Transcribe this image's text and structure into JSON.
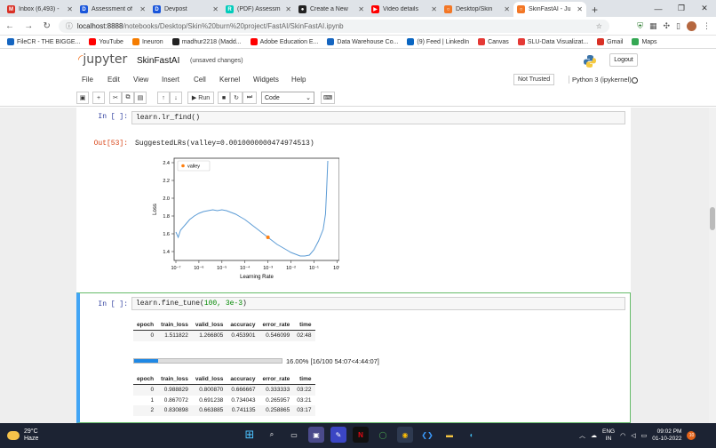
{
  "browser": {
    "tabs": [
      {
        "label": "Inbox (6,493) -",
        "icon": "gmail-icon",
        "color": "#d93025",
        "glyph": "M"
      },
      {
        "label": "Assessment of",
        "icon": "document-icon",
        "color": "#1a56db",
        "glyph": "D"
      },
      {
        "label": "Devpost",
        "icon": "document-icon",
        "color": "#1a56db",
        "glyph": "D"
      },
      {
        "label": "(PDF) Assessm",
        "icon": "researchgate-icon",
        "color": "#00ccbb",
        "glyph": "R"
      },
      {
        "label": "Create a New",
        "icon": "github-icon",
        "color": "#222222",
        "glyph": "●"
      },
      {
        "label": "Video details",
        "icon": "youtube-icon",
        "color": "#ff0000",
        "glyph": "▶"
      },
      {
        "label": "Desktop/Skin",
        "icon": "jupyter-icon",
        "color": "#f37726",
        "glyph": "○"
      },
      {
        "label": "SkinFastAI - Ju",
        "icon": "jupyter-icon",
        "color": "#f37726",
        "glyph": "○"
      }
    ],
    "new_tab": "+",
    "url_host": "localhost:8888",
    "url_path": "/notebooks/Desktop/Skin%20burn%20project/FastAI/SkinFastAI.ipynb",
    "bookmarks": [
      {
        "label": "FileCR - THE BIGGE...",
        "color": "#1565c0"
      },
      {
        "label": "YouTube",
        "color": "#ff0000"
      },
      {
        "label": "Ineuron",
        "color": "#f57c00"
      },
      {
        "label": "madhur2218 (Madd...",
        "color": "#222222"
      },
      {
        "label": "Adobe Education E...",
        "color": "#ff0000"
      },
      {
        "label": "Data Warehouse Co...",
        "color": "#1565c0"
      },
      {
        "label": "(9) Feed | LinkedIn",
        "color": "#0a66c2"
      },
      {
        "label": "Canvas",
        "color": "#e53935"
      },
      {
        "label": "SLU-Data Visualizat...",
        "color": "#e53935"
      },
      {
        "label": "Gmail",
        "color": "#d93025"
      },
      {
        "label": "Maps",
        "color": "#34a853"
      }
    ]
  },
  "jupyter": {
    "logo": "jupyter",
    "notebook_name": "SkinFastAI",
    "save_status": "(unsaved changes)",
    "logout": "Logout",
    "menu": [
      "File",
      "Edit",
      "View",
      "Insert",
      "Cell",
      "Kernel",
      "Widgets",
      "Help"
    ],
    "trusted": "Not Trusted",
    "kernel": "Python 3 (ipykernel)",
    "toolbar": {
      "run": "Run",
      "cell_type": "Code"
    }
  },
  "cells": {
    "cell1_prompt": "In [ ]:",
    "cell1_code": "learn.lr_find()",
    "out_prompt": "Out[53]:",
    "out_text": "SuggestedLRs(valley=0.0010000000474974513)",
    "cell2_prompt": "In [ ]:",
    "cell2_code_fn": "learn.fine_tune(",
    "cell2_code_args": "100, 3e-3",
    "cell2_code_end": ")"
  },
  "chart_data": {
    "type": "line",
    "xlabel": "Learning Rate",
    "ylabel": "Loss",
    "xscale": "log",
    "xlim": [
      1e-07,
      1
    ],
    "ylim": [
      1.3,
      2.45
    ],
    "xticks": [
      "10⁻⁷",
      "10⁻⁶",
      "10⁻⁵",
      "10⁻⁴",
      "10⁻³",
      "10⁻²",
      "10⁻¹",
      "10⁰"
    ],
    "yticks": [
      "1.4",
      "1.6",
      "1.8",
      "2.0",
      "2.2",
      "2.4"
    ],
    "legend": "valley",
    "legend_position": "top-left",
    "line_color": "#5b9bd5",
    "marker_color": "#ff7f0e",
    "series": {
      "log10_x": [
        -7,
        -6.9,
        -6.8,
        -6.6,
        -6.4,
        -6.2,
        -6.0,
        -5.8,
        -5.6,
        -5.4,
        -5.2,
        -5.0,
        -4.8,
        -4.6,
        -4.4,
        -4.2,
        -4.0,
        -3.8,
        -3.6,
        -3.4,
        -3.2,
        -3.0,
        -2.8,
        -2.6,
        -2.4,
        -2.2,
        -2.0,
        -1.8,
        -1.6,
        -1.4,
        -1.2,
        -1.0,
        -0.8,
        -0.6,
        -0.5,
        -0.45,
        -0.4
      ],
      "y": [
        1.62,
        1.56,
        1.64,
        1.7,
        1.76,
        1.8,
        1.83,
        1.85,
        1.86,
        1.87,
        1.86,
        1.87,
        1.86,
        1.84,
        1.82,
        1.79,
        1.76,
        1.72,
        1.68,
        1.64,
        1.6,
        1.56,
        1.52,
        1.48,
        1.45,
        1.42,
        1.39,
        1.37,
        1.35,
        1.35,
        1.36,
        1.42,
        1.52,
        1.65,
        1.82,
        2.1,
        2.42
      ]
    },
    "valley": {
      "log10_x": -3.0,
      "y": 1.56
    }
  },
  "epoch_table1": {
    "headers": [
      "epoch",
      "train_loss",
      "valid_loss",
      "accuracy",
      "error_rate",
      "time"
    ],
    "rows": [
      [
        "0",
        "1.511822",
        "1.266805",
        "0.453901",
        "0.546099",
        "02:48"
      ]
    ]
  },
  "progress": {
    "fraction": 0.16,
    "text": "16.00% [16/100 54:07<4:44:07]"
  },
  "epoch_table2": {
    "headers": [
      "epoch",
      "train_loss",
      "valid_loss",
      "accuracy",
      "error_rate",
      "time"
    ],
    "rows": [
      [
        "0",
        "0.988829",
        "0.800870",
        "0.666667",
        "0.333333",
        "03:22"
      ],
      [
        "1",
        "0.867072",
        "0.691238",
        "0.734043",
        "0.265957",
        "03:21"
      ],
      [
        "2",
        "0.830898",
        "0.663885",
        "0.741135",
        "0.258865",
        "03:17"
      ]
    ]
  },
  "taskbar": {
    "temp": "29°C",
    "weather": "Haze",
    "lang1": "ENG",
    "lang2": "IN",
    "time": "09:02 PM",
    "date": "01-10-2022",
    "badge": "10"
  }
}
